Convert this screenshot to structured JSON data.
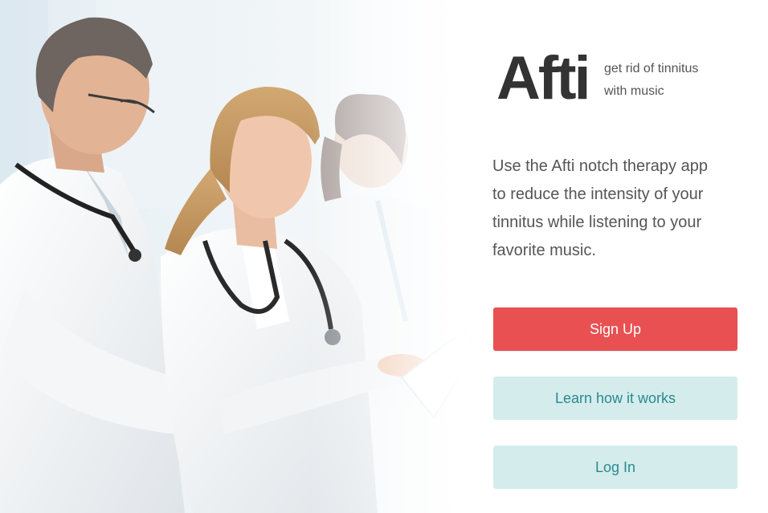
{
  "brand": {
    "name": "Afti",
    "tagline_line1": "get rid of tinnitus",
    "tagline_line2": "with music"
  },
  "intro": {
    "line1": "Use the Afti notch therapy app",
    "line2": "to reduce the intensity of your",
    "line3": "tinnitus while listening to your",
    "line4": "favorite music."
  },
  "actions": {
    "sign_up_label": "Sign Up",
    "learn_label": "Learn how it works",
    "login_label": "Log In"
  },
  "hero": {
    "image_description": "doctors-photo"
  },
  "colors": {
    "primary": "#e85052",
    "secondary_bg": "#d5eced",
    "secondary_text": "#2a8a8e",
    "text": "#555555",
    "brand_text": "#333333"
  }
}
